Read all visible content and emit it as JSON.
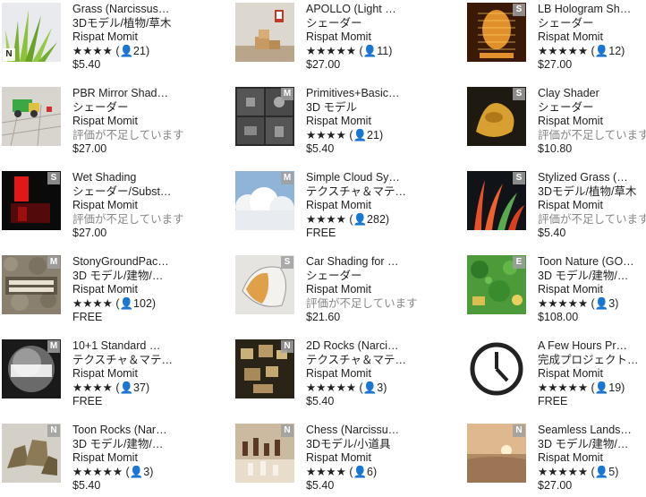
{
  "items": [
    {
      "title": "Grass (Narcissus…",
      "category": "3Dモデル/植物/草木",
      "publisher": "Rispat Momit",
      "stars": "★★★★",
      "reviews": "(👤21)",
      "price": "$5.40",
      "badge": "N"
    },
    {
      "title": "APOLLO (Light …",
      "category": "シェーダー",
      "publisher": "Rispat Momit",
      "stars": "★★★★★",
      "reviews": "(👤11)",
      "price": "$27.00",
      "badge": ""
    },
    {
      "title": "LB Hologram Sh…",
      "category": "シェーダー",
      "publisher": "Rispat Momit",
      "stars": "★★★★★",
      "reviews": "(👤12)",
      "price": "$27.00",
      "badge": "S"
    },
    {
      "title": "PBR Mirror Shad…",
      "category": "シェーダー",
      "publisher": "Rispat Momit",
      "note": "評価が不足しています",
      "price": "$27.00",
      "badge": ""
    },
    {
      "title": "Primitives+Basic…",
      "category": "3D モデル",
      "publisher": "Rispat Momit",
      "stars": "★★★★",
      "reviews": "(👤21)",
      "price": "$5.40",
      "badge": "M"
    },
    {
      "title": "Clay Shader",
      "category": "シェーダー",
      "publisher": "Rispat Momit",
      "note": "評価が不足しています",
      "price": "$10.80",
      "badge": "S"
    },
    {
      "title": "Wet Shading",
      "category": "シェーダー/Subst…",
      "publisher": "Rispat Momit",
      "note": "評価が不足しています",
      "price": "$27.00",
      "badge": "S"
    },
    {
      "title": "Simple Cloud Sy…",
      "category": "テクスチャ＆マテ…",
      "publisher": "Rispat Momit",
      "stars": "★★★★",
      "reviews": "(👤282)",
      "price": "FREE",
      "badge": "M"
    },
    {
      "title": "Stylized Grass (…",
      "category": "3Dモデル/植物/草木",
      "publisher": "Rispat Momit",
      "note": "評価が不足しています",
      "price": "$5.40",
      "badge": "S"
    },
    {
      "title": "StonyGroundPac…",
      "category": "3D モデル/建物/…",
      "publisher": "Rispat Momit",
      "stars": "★★★★",
      "reviews": "(👤102)",
      "price": "FREE",
      "badge": "M"
    },
    {
      "title": "Car Shading for …",
      "category": "シェーダー",
      "publisher": "Rispat Momit",
      "note": "評価が不足しています",
      "price": "$21.60",
      "badge": "S"
    },
    {
      "title": "Toon Nature (GO…",
      "category": "3D モデル/建物/…",
      "publisher": "Rispat Momit",
      "stars": "★★★★★",
      "reviews": "(👤3)",
      "price": "$108.00",
      "badge": "E"
    },
    {
      "title": "10+1 Standard …",
      "category": "テクスチャ＆マテ…",
      "publisher": "Rispat Momit",
      "stars": "★★★★",
      "reviews": "(👤37)",
      "price": "FREE",
      "badge": "M"
    },
    {
      "title": "2D Rocks (Narci…",
      "category": "テクスチャ＆マテ…",
      "publisher": "Rispat Momit",
      "stars": "★★★★★",
      "reviews": "(👤3)",
      "price": "$5.40",
      "badge": "N"
    },
    {
      "title": "A Few Hours Pr…",
      "category": "完成プロジェクト…",
      "publisher": "Rispat Momit",
      "stars": "★★★★★",
      "reviews": "(👤19)",
      "price": "FREE",
      "badge": ""
    },
    {
      "title": "Toon Rocks (Nar…",
      "category": "3D モデル/建物/…",
      "publisher": "Rispat Momit",
      "stars": "★★★★★",
      "reviews": "(👤3)",
      "price": "$5.40",
      "badge": "N"
    },
    {
      "title": "Chess (Narcissu…",
      "category": "3Dモデル/小道具",
      "publisher": "Rispat Momit",
      "stars": "★★★★",
      "reviews": "(👤6)",
      "price": "$5.40",
      "badge": "N"
    },
    {
      "title": "Seamless Lands…",
      "category": "3D モデル/建物/…",
      "publisher": "Rispat Momit",
      "stars": "★★★★★",
      "reviews": "(👤5)",
      "price": "$27.00",
      "badge": "N"
    }
  ]
}
